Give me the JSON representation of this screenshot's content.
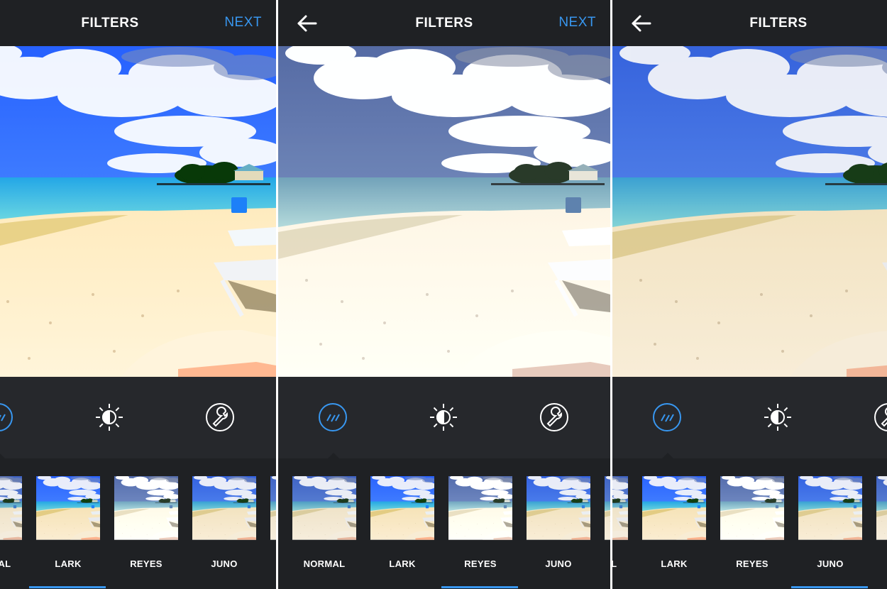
{
  "colors": {
    "accent": "#3897f0",
    "bar": "#1f2124",
    "toolbar": "#26282c"
  },
  "screens": [
    {
      "title": "FILTERS",
      "next_label": "NEXT",
      "has_back": false,
      "selected_filter": "LARK",
      "filters": [
        "NORMAL",
        "LARK",
        "REYES",
        "JUNO"
      ]
    },
    {
      "title": "FILTERS",
      "next_label": "NEXT",
      "has_back": true,
      "selected_filter": "REYES",
      "filters": [
        "NORMAL",
        "LARK",
        "REYES",
        "JUNO"
      ]
    },
    {
      "title": "FILTERS",
      "next_label": "",
      "has_back": true,
      "selected_filter": "JUNO",
      "filters": [
        "NORMAL",
        "LARK",
        "REYES",
        "JUNO"
      ]
    }
  ],
  "tool_icons": [
    "filter-icon",
    "lux-icon",
    "edit-icon"
  ]
}
